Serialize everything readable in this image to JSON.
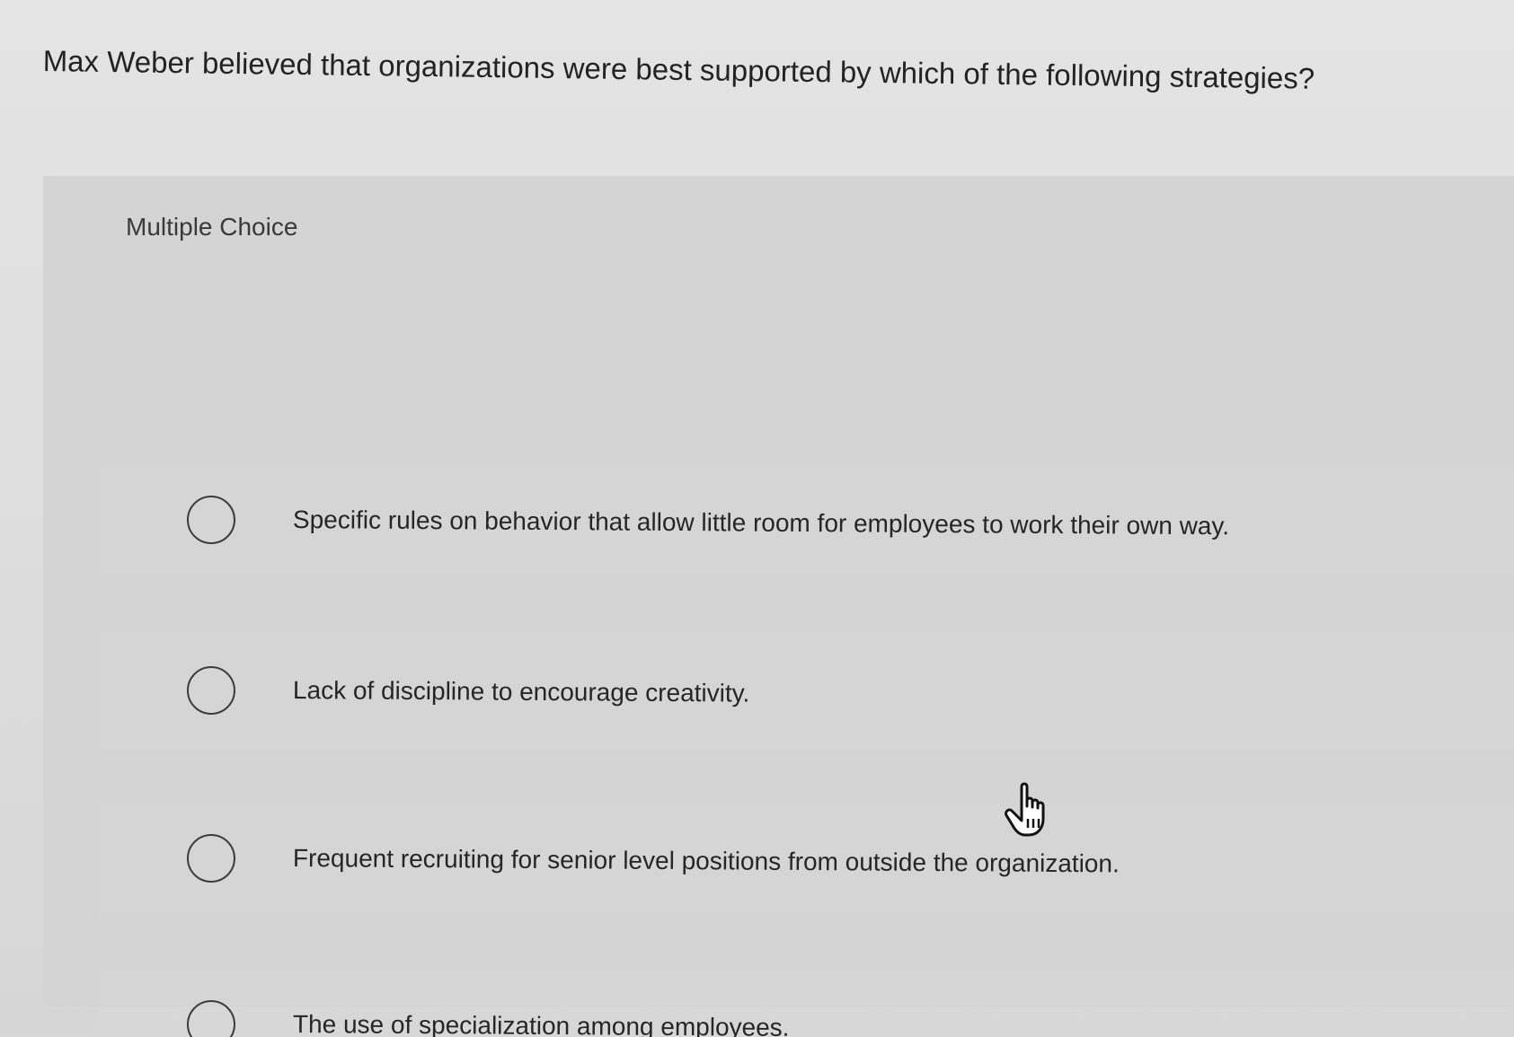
{
  "question": {
    "text": "Max Weber believed that organizations were best supported by which of the following strategies?"
  },
  "quiz": {
    "type_label": "Multiple Choice",
    "options": [
      {
        "label": "Specific rules on behavior that allow little room for employees to work their own way.",
        "selected": false
      },
      {
        "label": "Lack of discipline to encourage creativity.",
        "selected": false
      },
      {
        "label": "Frequent recruiting for senior level positions from outside the organization.",
        "selected": false
      },
      {
        "label": "The use of specialization among employees.",
        "selected": false
      }
    ]
  },
  "cursor": {
    "icon": "hand-pointer-icon"
  }
}
